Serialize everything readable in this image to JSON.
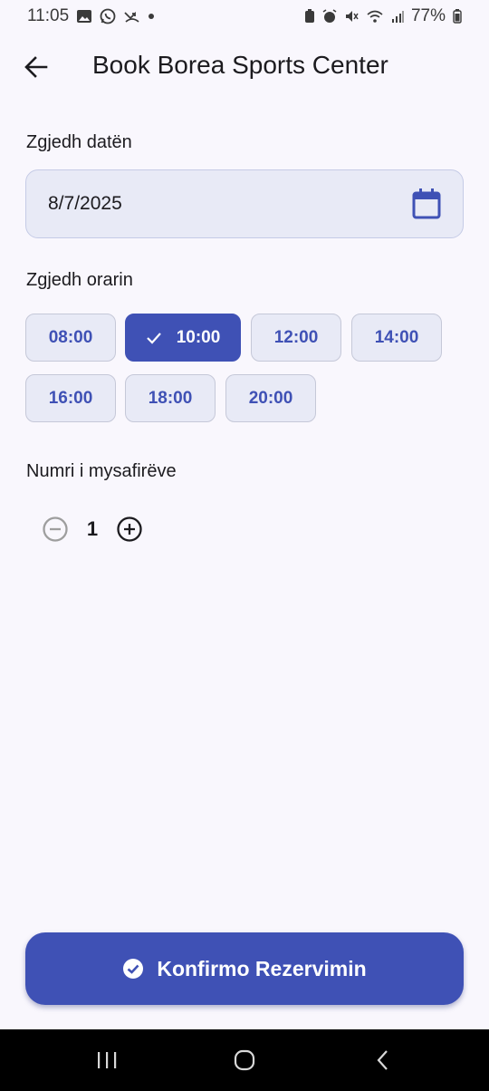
{
  "status_bar": {
    "time": "11:05",
    "battery": "77%"
  },
  "app_bar": {
    "title": "Book Borea Sports Center"
  },
  "date_section": {
    "label": "Zgjedh datën",
    "value": "8/7/2025"
  },
  "time_section": {
    "label": "Zgjedh orarin",
    "slots": [
      {
        "label": "08:00",
        "selected": false
      },
      {
        "label": "10:00",
        "selected": true
      },
      {
        "label": "12:00",
        "selected": false
      },
      {
        "label": "14:00",
        "selected": false
      },
      {
        "label": "16:00",
        "selected": false
      },
      {
        "label": "18:00",
        "selected": false
      },
      {
        "label": "20:00",
        "selected": false
      }
    ]
  },
  "guests_section": {
    "label": "Numri i mysafirëve",
    "count": "1"
  },
  "confirm_button": {
    "label": "Konfirmo Rezervimin"
  },
  "colors": {
    "primary": "#3f51b5",
    "chip_bg": "#e8eaf6",
    "background": "#f9f7fd"
  },
  "icons": {
    "back": "arrow-left-icon",
    "calendar": "calendar-icon",
    "check": "check-icon",
    "minus": "minus-circle-icon",
    "plus": "plus-circle-icon",
    "confirm": "check-circle-icon"
  }
}
